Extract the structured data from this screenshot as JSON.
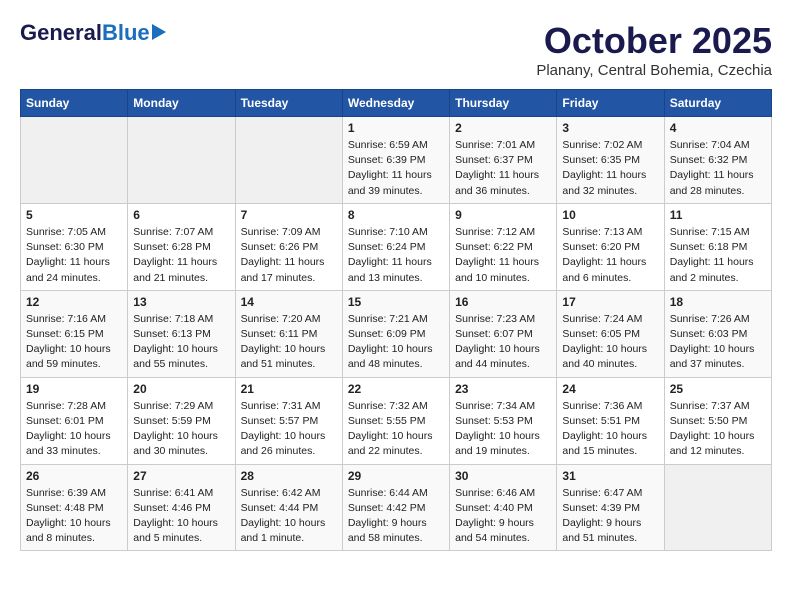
{
  "logo": {
    "general": "General",
    "blue": "Blue"
  },
  "header": {
    "month": "October 2025",
    "location": "Planany, Central Bohemia, Czechia"
  },
  "days_of_week": [
    "Sunday",
    "Monday",
    "Tuesday",
    "Wednesday",
    "Thursday",
    "Friday",
    "Saturday"
  ],
  "weeks": [
    [
      {
        "day": "",
        "info": ""
      },
      {
        "day": "",
        "info": ""
      },
      {
        "day": "",
        "info": ""
      },
      {
        "day": "1",
        "info": "Sunrise: 6:59 AM\nSunset: 6:39 PM\nDaylight: 11 hours\nand 39 minutes."
      },
      {
        "day": "2",
        "info": "Sunrise: 7:01 AM\nSunset: 6:37 PM\nDaylight: 11 hours\nand 36 minutes."
      },
      {
        "day": "3",
        "info": "Sunrise: 7:02 AM\nSunset: 6:35 PM\nDaylight: 11 hours\nand 32 minutes."
      },
      {
        "day": "4",
        "info": "Sunrise: 7:04 AM\nSunset: 6:32 PM\nDaylight: 11 hours\nand 28 minutes."
      }
    ],
    [
      {
        "day": "5",
        "info": "Sunrise: 7:05 AM\nSunset: 6:30 PM\nDaylight: 11 hours\nand 24 minutes."
      },
      {
        "day": "6",
        "info": "Sunrise: 7:07 AM\nSunset: 6:28 PM\nDaylight: 11 hours\nand 21 minutes."
      },
      {
        "day": "7",
        "info": "Sunrise: 7:09 AM\nSunset: 6:26 PM\nDaylight: 11 hours\nand 17 minutes."
      },
      {
        "day": "8",
        "info": "Sunrise: 7:10 AM\nSunset: 6:24 PM\nDaylight: 11 hours\nand 13 minutes."
      },
      {
        "day": "9",
        "info": "Sunrise: 7:12 AM\nSunset: 6:22 PM\nDaylight: 11 hours\nand 10 minutes."
      },
      {
        "day": "10",
        "info": "Sunrise: 7:13 AM\nSunset: 6:20 PM\nDaylight: 11 hours\nand 6 minutes."
      },
      {
        "day": "11",
        "info": "Sunrise: 7:15 AM\nSunset: 6:18 PM\nDaylight: 11 hours\nand 2 minutes."
      }
    ],
    [
      {
        "day": "12",
        "info": "Sunrise: 7:16 AM\nSunset: 6:15 PM\nDaylight: 10 hours\nand 59 minutes."
      },
      {
        "day": "13",
        "info": "Sunrise: 7:18 AM\nSunset: 6:13 PM\nDaylight: 10 hours\nand 55 minutes."
      },
      {
        "day": "14",
        "info": "Sunrise: 7:20 AM\nSunset: 6:11 PM\nDaylight: 10 hours\nand 51 minutes."
      },
      {
        "day": "15",
        "info": "Sunrise: 7:21 AM\nSunset: 6:09 PM\nDaylight: 10 hours\nand 48 minutes."
      },
      {
        "day": "16",
        "info": "Sunrise: 7:23 AM\nSunset: 6:07 PM\nDaylight: 10 hours\nand 44 minutes."
      },
      {
        "day": "17",
        "info": "Sunrise: 7:24 AM\nSunset: 6:05 PM\nDaylight: 10 hours\nand 40 minutes."
      },
      {
        "day": "18",
        "info": "Sunrise: 7:26 AM\nSunset: 6:03 PM\nDaylight: 10 hours\nand 37 minutes."
      }
    ],
    [
      {
        "day": "19",
        "info": "Sunrise: 7:28 AM\nSunset: 6:01 PM\nDaylight: 10 hours\nand 33 minutes."
      },
      {
        "day": "20",
        "info": "Sunrise: 7:29 AM\nSunset: 5:59 PM\nDaylight: 10 hours\nand 30 minutes."
      },
      {
        "day": "21",
        "info": "Sunrise: 7:31 AM\nSunset: 5:57 PM\nDaylight: 10 hours\nand 26 minutes."
      },
      {
        "day": "22",
        "info": "Sunrise: 7:32 AM\nSunset: 5:55 PM\nDaylight: 10 hours\nand 22 minutes."
      },
      {
        "day": "23",
        "info": "Sunrise: 7:34 AM\nSunset: 5:53 PM\nDaylight: 10 hours\nand 19 minutes."
      },
      {
        "day": "24",
        "info": "Sunrise: 7:36 AM\nSunset: 5:51 PM\nDaylight: 10 hours\nand 15 minutes."
      },
      {
        "day": "25",
        "info": "Sunrise: 7:37 AM\nSunset: 5:50 PM\nDaylight: 10 hours\nand 12 minutes."
      }
    ],
    [
      {
        "day": "26",
        "info": "Sunrise: 6:39 AM\nSunset: 4:48 PM\nDaylight: 10 hours\nand 8 minutes."
      },
      {
        "day": "27",
        "info": "Sunrise: 6:41 AM\nSunset: 4:46 PM\nDaylight: 10 hours\nand 5 minutes."
      },
      {
        "day": "28",
        "info": "Sunrise: 6:42 AM\nSunset: 4:44 PM\nDaylight: 10 hours\nand 1 minute."
      },
      {
        "day": "29",
        "info": "Sunrise: 6:44 AM\nSunset: 4:42 PM\nDaylight: 9 hours\nand 58 minutes."
      },
      {
        "day": "30",
        "info": "Sunrise: 6:46 AM\nSunset: 4:40 PM\nDaylight: 9 hours\nand 54 minutes."
      },
      {
        "day": "31",
        "info": "Sunrise: 6:47 AM\nSunset: 4:39 PM\nDaylight: 9 hours\nand 51 minutes."
      },
      {
        "day": "",
        "info": ""
      }
    ]
  ]
}
